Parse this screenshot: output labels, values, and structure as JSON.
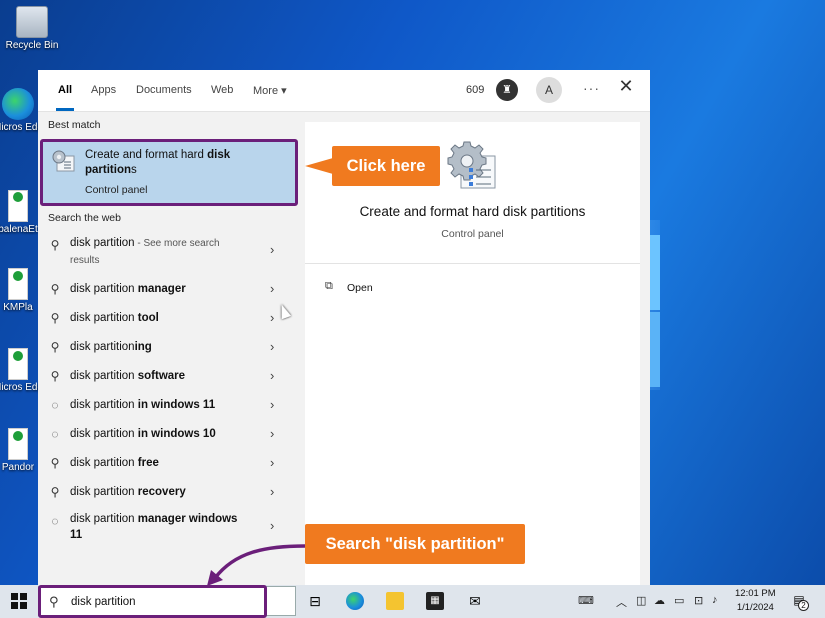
{
  "desktop": {
    "icons": [
      {
        "label": "Recycle Bin"
      },
      {
        "label": "Micros Edg"
      },
      {
        "label": "balenaEt"
      },
      {
        "label": "KMPla"
      },
      {
        "label": "Micros Edg"
      },
      {
        "label": "Pandor"
      }
    ]
  },
  "search_panel": {
    "tabs": [
      "All",
      "Apps",
      "Documents",
      "Web",
      "More"
    ],
    "more_caret": "▾",
    "points": "609",
    "avatar_letter": "A",
    "more_options": "···",
    "close": "✕",
    "best_match_label": "Best match",
    "best_match": {
      "title_plain": "Create and format hard ",
      "title_bold": "disk",
      "title_line2_bold": "partition",
      "title_line2_suffix": "s",
      "subtitle": "Control panel"
    },
    "web_label": "Search the web",
    "web_results": [
      {
        "icon": "search-icon",
        "prefix": "disk partition",
        "bold": "",
        "suffix": " - See more search",
        "extra": "results"
      },
      {
        "icon": "search-icon",
        "prefix": "disk partition ",
        "bold": "manager",
        "suffix": "",
        "extra": ""
      },
      {
        "icon": "search-icon",
        "prefix": "disk partition ",
        "bold": "tool",
        "suffix": "",
        "extra": ""
      },
      {
        "icon": "search-icon",
        "prefix": "disk partition",
        "bold": "ing",
        "suffix": "",
        "extra": ""
      },
      {
        "icon": "search-icon",
        "prefix": "disk partition ",
        "bold": "software",
        "suffix": "",
        "extra": ""
      },
      {
        "icon": "chat-icon",
        "prefix": "disk partition ",
        "bold": "in windows 11",
        "suffix": "",
        "extra": ""
      },
      {
        "icon": "chat-icon",
        "prefix": "disk partition ",
        "bold": "in windows 10",
        "suffix": "",
        "extra": ""
      },
      {
        "icon": "search-icon",
        "prefix": "disk partition ",
        "bold": "free",
        "suffix": "",
        "extra": ""
      },
      {
        "icon": "search-icon",
        "prefix": "disk partition ",
        "bold": "recovery",
        "suffix": "",
        "extra": ""
      },
      {
        "icon": "chat-icon",
        "prefix": "disk partition ",
        "bold": "manager windows",
        "suffix": "",
        "extra": "11"
      }
    ],
    "preview": {
      "title": "Create and format hard disk partitions",
      "subtitle": "Control panel",
      "open_label": "Open"
    }
  },
  "callouts": {
    "click_here": "Click here",
    "search_hint": "Search \"disk partition\""
  },
  "taskbar": {
    "search_value": "disk partition",
    "time": "12:01 PM",
    "date": "1/1/2024",
    "notification_count": "2"
  }
}
